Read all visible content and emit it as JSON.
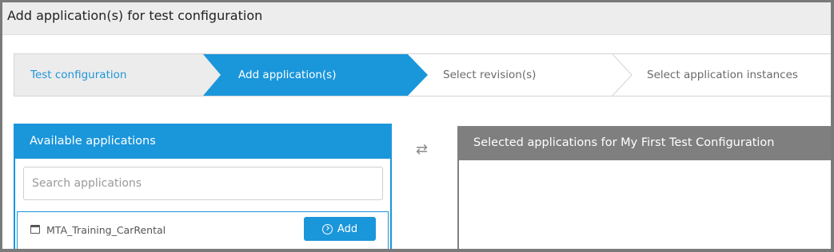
{
  "header": {
    "title": "Add application(s) for test configuration"
  },
  "wizard": {
    "steps": [
      {
        "label": "Test configuration",
        "state": "completed"
      },
      {
        "label": "Add application(s)",
        "state": "active"
      },
      {
        "label": "Select revision(s)",
        "state": "upcoming"
      },
      {
        "label": "Select application instances",
        "state": "upcoming"
      }
    ]
  },
  "available": {
    "title": "Available applications",
    "search_placeholder": "Search applications",
    "search_value": "",
    "items": [
      {
        "name": "MTA_Training_CarRental",
        "icon": "window-icon",
        "action_label": "Add",
        "action_icon": "circle-arrow-right-icon"
      }
    ]
  },
  "transfer_icon": "swap-arrows-icon",
  "selected": {
    "title": "Selected applications for My First Test Configuration",
    "items": []
  },
  "colors": {
    "accent": "#1a96db",
    "header_bg": "#ededed",
    "selected_header": "#7f7f7f",
    "completed_step_bg": "#ececec"
  }
}
